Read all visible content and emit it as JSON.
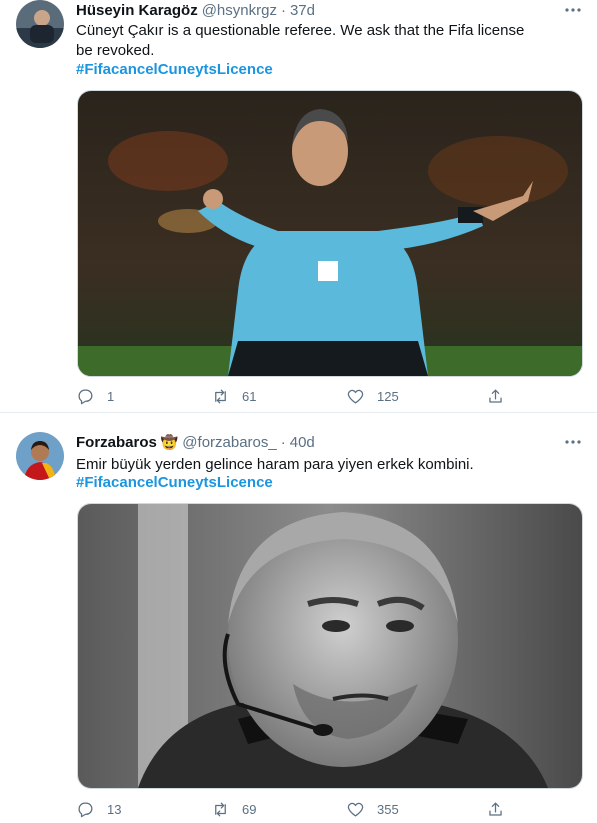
{
  "tweets": [
    {
      "name": "Hüseyin Karagöz",
      "handle": "@hsynkrgz",
      "separator": "·",
      "time": "37d",
      "text": "Cüneyt Çakır is a questionable referee. We ask that the Fifa license be revoked.",
      "hashtag": "#FifacancelCuneytsLicence",
      "replies": "1",
      "retweets": "61",
      "likes": "125"
    },
    {
      "name": "Forzabaros",
      "badge": "🤠",
      "handle": "@forzabaros_",
      "separator": "·",
      "time": "40d",
      "text": "Emir büyük yerden gelince haram para yiyen erkek kombini.",
      "hashtag": "#FifacancelCuneytsLicence",
      "replies": "13",
      "retweets": "69",
      "likes": "355"
    }
  ],
  "icons": [
    "more-icon",
    "reply-icon",
    "retweet-icon",
    "like-icon",
    "share-icon"
  ],
  "colors": {
    "hashtag": "#1b95e0",
    "secondary_text": "#5b7083",
    "divider": "#e6ecf0"
  }
}
